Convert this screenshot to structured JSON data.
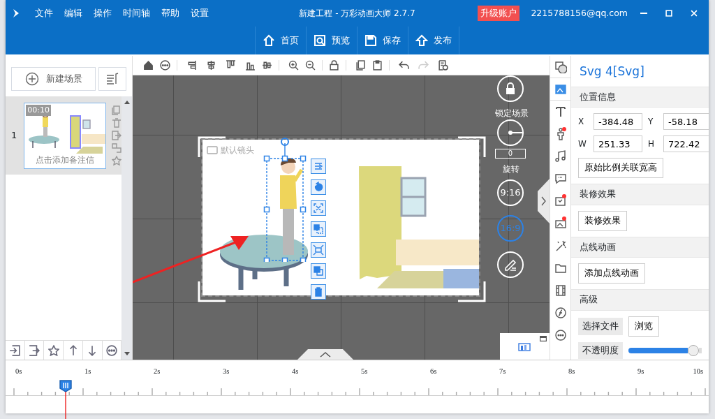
{
  "window": {
    "title": "新建工程 - 万彩动画大师 2.7.7",
    "menu": [
      "文件",
      "编辑",
      "操作",
      "时间轴",
      "帮助",
      "设置"
    ],
    "upgrade": "升级账户",
    "account": "2215788156@qq.com"
  },
  "main_toolbar": [
    {
      "label": "首页"
    },
    {
      "label": "预览"
    },
    {
      "label": "保存"
    },
    {
      "label": "发布"
    }
  ],
  "scenes": {
    "new_label": "新建场景",
    "items": [
      {
        "number": "1",
        "duration": "00:10",
        "note": "点击添加备注信",
        "selected": true
      }
    ]
  },
  "canvas": {
    "camera_label": "默认镜头",
    "lock_label": "锁定场景",
    "rotation": "0",
    "rotate_label": "旋转",
    "ratios": [
      {
        "label": "9:16",
        "selected": false
      },
      {
        "label": "16:9",
        "selected": true
      }
    ]
  },
  "tools": [
    {
      "badge": false
    },
    {
      "badge": false
    },
    {
      "badge": false
    },
    {
      "badge": true
    },
    {
      "badge": false
    },
    {
      "badge": false
    },
    {
      "badge": true
    },
    {
      "badge": true
    },
    {
      "badge": false
    },
    {
      "badge": false
    },
    {
      "badge": false
    },
    {
      "badge": false
    },
    {
      "badge": false
    }
  ],
  "properties": {
    "title": "Svg 4[Svg]",
    "position_header": "位置信息",
    "fields": [
      {
        "label": "X",
        "value": "-384.48"
      },
      {
        "label": "Y",
        "value": "-58.18"
      },
      {
        "label": "W",
        "value": "251.33"
      },
      {
        "label": "H",
        "value": "722.42"
      }
    ],
    "ratio_button": "原始比例关联宽高",
    "decor_header": "装修效果",
    "decor_button": "装修效果",
    "path_header": "点线动画",
    "path_button": "添加点线动画",
    "advanced_header": "高级",
    "file_label": "选择文件",
    "browse_button": "浏览",
    "opacity_label": "不透明度",
    "opacity": {
      "level": 0.95
    }
  },
  "timeline": {
    "ticks": [
      "0s",
      "1s",
      "2s",
      "3s",
      "4s",
      "5s",
      "6s",
      "7s",
      "8s",
      "9s",
      "10s"
    ],
    "playhead": {
      "level": 0.075
    }
  }
}
